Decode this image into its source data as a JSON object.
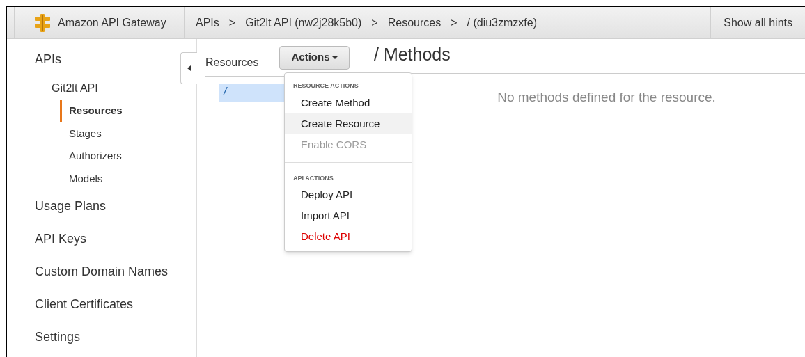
{
  "header": {
    "brand": "Amazon API Gateway",
    "breadcrumbs": [
      "APIs",
      "Git2lt API (nw2j28k5b0)",
      "Resources",
      "/ (diu3zmzxfe)"
    ],
    "separator": ">",
    "hints_button": "Show all hints"
  },
  "sidebar": {
    "items": [
      {
        "label": "APIs",
        "selected": false,
        "children": [
          {
            "label": "Git2lt API",
            "selected": false,
            "children": [
              {
                "label": "Resources",
                "selected": true
              },
              {
                "label": "Stages",
                "selected": false
              },
              {
                "label": "Authorizers",
                "selected": false
              },
              {
                "label": "Models",
                "selected": false
              }
            ]
          }
        ]
      },
      {
        "label": "Usage Plans",
        "selected": false
      },
      {
        "label": "API Keys",
        "selected": false
      },
      {
        "label": "Custom Domain Names",
        "selected": false
      },
      {
        "label": "Client Certificates",
        "selected": false
      },
      {
        "label": "Settings",
        "selected": false
      }
    ]
  },
  "resources": {
    "title": "Resources",
    "actions_button": "Actions",
    "tree": [
      {
        "label": "/",
        "selected": true
      }
    ]
  },
  "actions_menu": {
    "groups": [
      {
        "heading": "RESOURCE ACTIONS",
        "items": [
          {
            "label": "Create Method",
            "highlighted": false,
            "disabled": false,
            "destructive": false
          },
          {
            "label": "Create Resource",
            "highlighted": true,
            "disabled": false,
            "destructive": false
          },
          {
            "label": "Enable CORS",
            "highlighted": false,
            "disabled": true,
            "destructive": false
          }
        ]
      },
      {
        "heading": "API ACTIONS",
        "items": [
          {
            "label": "Deploy API",
            "highlighted": false,
            "disabled": false,
            "destructive": false
          },
          {
            "label": "Import API",
            "highlighted": false,
            "disabled": false,
            "destructive": false
          },
          {
            "label": "Delete API",
            "highlighted": false,
            "disabled": false,
            "destructive": true
          }
        ]
      }
    ]
  },
  "methods": {
    "title": "/ Methods",
    "empty_message": "No methods defined for the resource."
  }
}
